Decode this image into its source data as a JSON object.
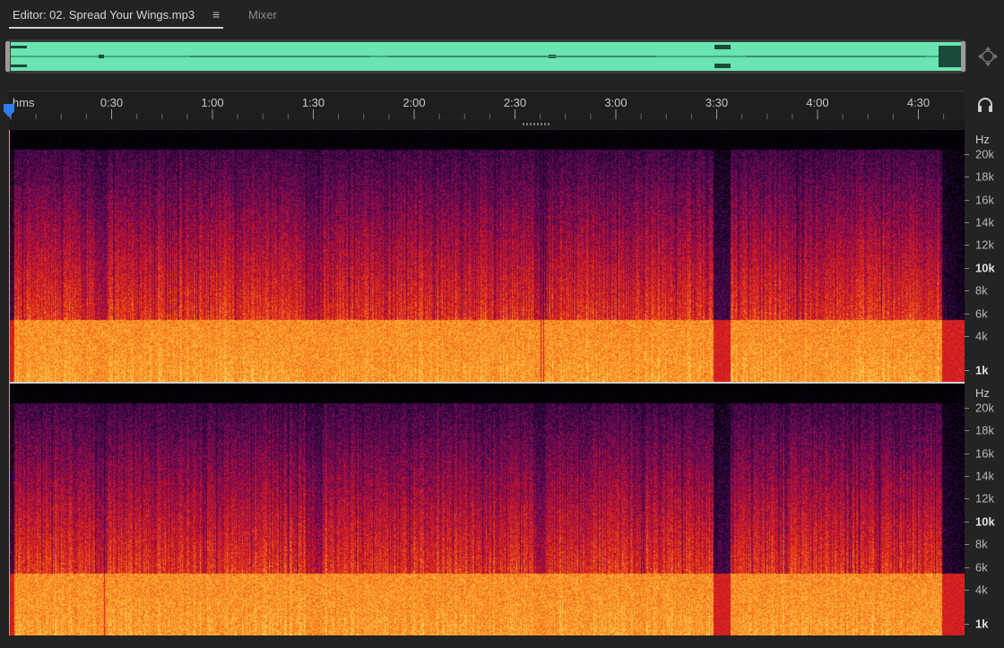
{
  "tabs": {
    "editor_label": "Editor: 02. Spread Your Wings.mp3",
    "menu_glyph": "≡",
    "mixer_label": "Mixer"
  },
  "overview": {
    "waveform_color": "#6ae4b0",
    "zoom_icon": "zoom-navigator-icon"
  },
  "ruler": {
    "unit": "hms",
    "labels": [
      "0:30",
      "1:00",
      "1:30",
      "2:00",
      "2:30",
      "3:00",
      "3:30",
      "4:00",
      "4:30"
    ],
    "label_seconds": [
      30,
      60,
      90,
      120,
      150,
      180,
      210,
      240,
      270
    ],
    "total_seconds": 284,
    "playhead_icon": "playhead-marker-icon",
    "headphone_icon": "headphone-icon"
  },
  "frequency_axis": {
    "unit": "Hz",
    "labels": [
      "20k",
      "18k",
      "16k",
      "14k",
      "12k",
      "10k",
      "8k",
      "6k",
      "4k",
      "1k"
    ],
    "values_hz": [
      20000,
      18000,
      16000,
      14000,
      12000,
      10000,
      8000,
      6000,
      4000,
      1000
    ],
    "bold_labels": [
      "10k",
      "1k"
    ]
  },
  "spectrogram": {
    "channels": 2,
    "colors": {
      "low": "#000000",
      "purple": "#3d0a4d",
      "red": "#c8102e",
      "orange": "#f06a18",
      "yellow": "#ffe060"
    }
  }
}
